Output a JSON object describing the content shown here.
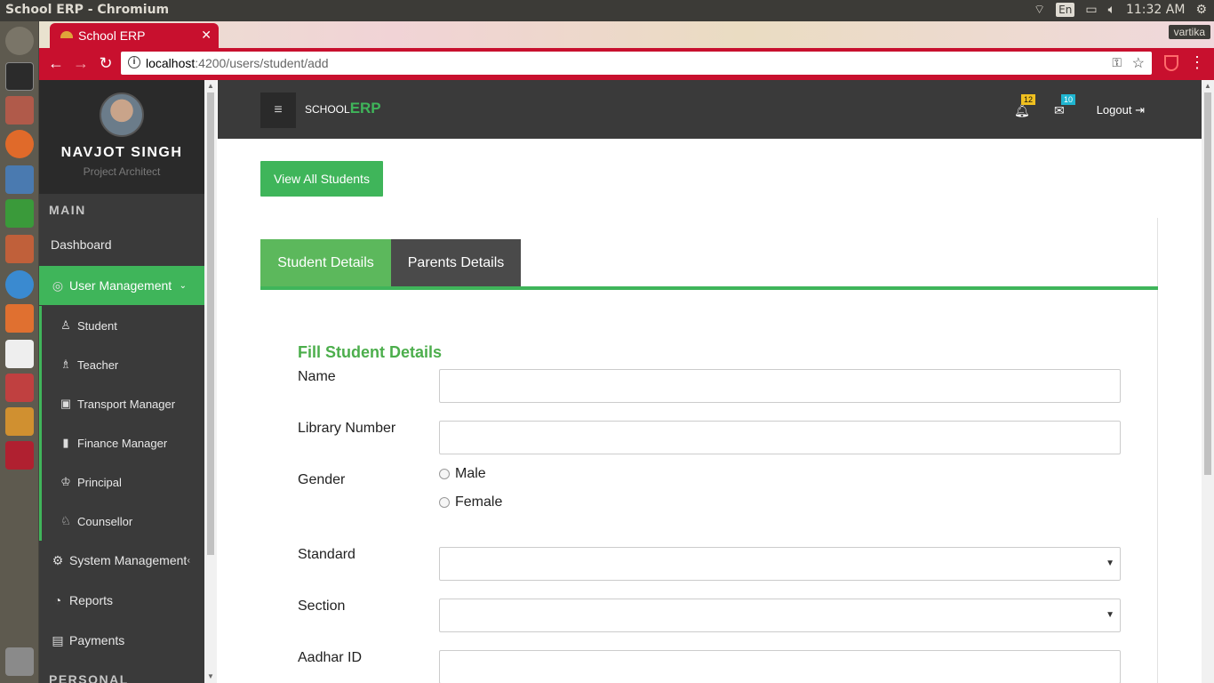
{
  "os": {
    "window_title": "School ERP - Chromium",
    "lang": "En",
    "time": "11:32 AM",
    "user_badge": "vartika"
  },
  "browser": {
    "tab_title": "School ERP",
    "url_host": "localhost",
    "url_rest": ":4200/users/student/add"
  },
  "profile": {
    "name": "NAVJOT SINGH",
    "role": "Project Architect"
  },
  "sidebar": {
    "main_heading": "MAIN",
    "personal_heading": "PERSONAL",
    "dashboard": "Dashboard",
    "user_management": "User Management",
    "sub_items": [
      "Student",
      "Teacher",
      "Transport Manager",
      "Finance Manager",
      "Principal",
      "Counsellor"
    ],
    "system_management": "System Management",
    "reports": "Reports",
    "payments": "Payments"
  },
  "appbar": {
    "brand_small": "SCHOOL",
    "brand_big": "ERP",
    "notifications_count": "12",
    "messages_count": "10",
    "logout": "Logout"
  },
  "page": {
    "view_all_button": "View All Students",
    "tab_student": "Student Details",
    "tab_parents": "Parents Details",
    "form_title": "Fill Student Details",
    "labels": {
      "name": "Name",
      "library_number": "Library Number",
      "gender": "Gender",
      "standard": "Standard",
      "section": "Section",
      "aadhar": "Aadhar ID"
    },
    "gender_options": [
      "Male",
      "Female"
    ]
  },
  "colors": {
    "accent_green": "#3fb55a",
    "browser_red": "#c8102e",
    "dark_panel": "#3a3a3a"
  }
}
